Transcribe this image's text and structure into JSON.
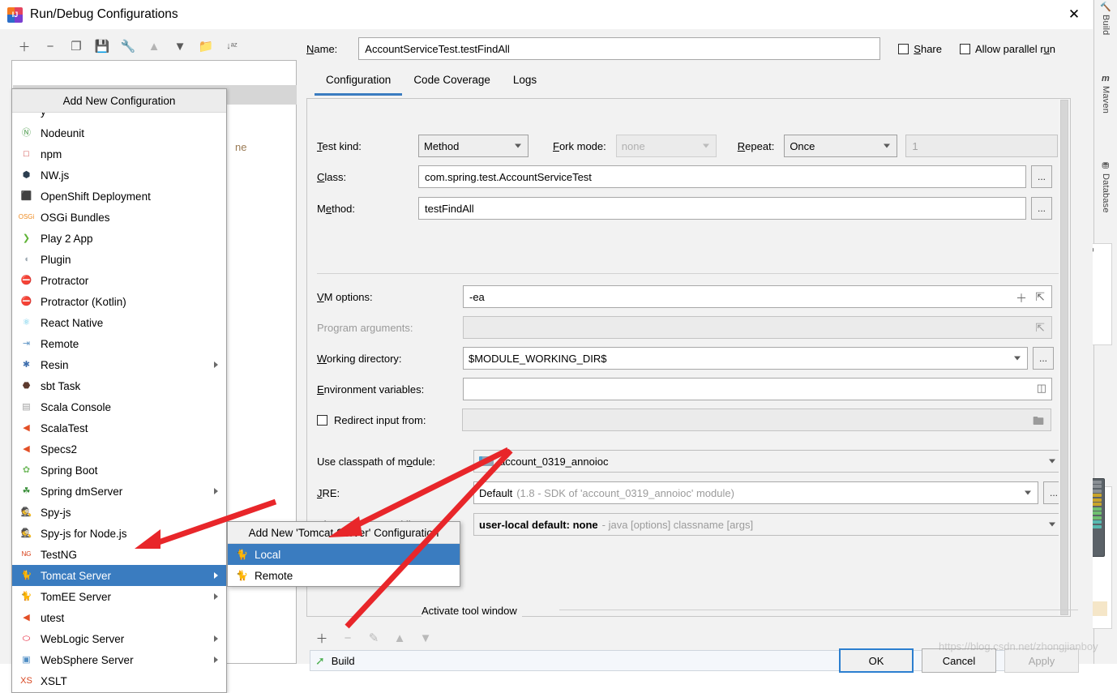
{
  "window": {
    "title": "Run/Debug Configurations",
    "app_icon": "intellij-idea-icon",
    "close_label": "✕"
  },
  "left_toolbar": {
    "items": [
      {
        "name": "add-configuration-button",
        "glyph": "＋",
        "dim": false
      },
      {
        "name": "remove-configuration-button",
        "glyph": "−",
        "dim": false
      },
      {
        "name": "copy-configuration-button",
        "glyph": "❐",
        "dim": false
      },
      {
        "name": "save-configuration-button",
        "glyph": "💾",
        "dim": false
      },
      {
        "name": "edit-templates-button",
        "glyph": "🔧",
        "dim": false
      },
      {
        "name": "move-up-button",
        "glyph": "▲",
        "dim": true
      },
      {
        "name": "move-down-button",
        "glyph": "▼",
        "dim": false
      },
      {
        "name": "create-folder-button",
        "glyph": "📁",
        "dim": false
      },
      {
        "name": "sort-alphabetically-button",
        "glyph": "↓ᵃᶻ",
        "dim": false
      }
    ]
  },
  "config_tree": {
    "partial_text": "ne"
  },
  "add_new_popup": {
    "header": "Add New Configuration",
    "clipped_top_item": "·",
    "items": [
      {
        "label": "Nodeunit",
        "icon": "nodeunit-icon",
        "glyph": "Ⓝ",
        "color": "#4f9d4f",
        "submenu": false,
        "selected": false
      },
      {
        "label": "npm",
        "icon": "npm-icon",
        "glyph": "□",
        "color": "#cb3837",
        "submenu": false,
        "selected": false
      },
      {
        "label": "NW.js",
        "icon": "nwjs-icon",
        "glyph": "⬢",
        "color": "#2c3e50",
        "submenu": false,
        "selected": false
      },
      {
        "label": "OpenShift Deployment",
        "icon": "openshift-icon",
        "glyph": "⬛",
        "color": "#6e6e6e",
        "submenu": false,
        "selected": false
      },
      {
        "label": "OSGi Bundles",
        "icon": "osgi-icon",
        "glyph": "OSGi",
        "color": "#ef8b20",
        "submenu": false,
        "selected": false
      },
      {
        "label": "Play 2 App",
        "icon": "play2-icon",
        "glyph": "❯",
        "color": "#5fb336",
        "submenu": false,
        "selected": false
      },
      {
        "label": "Plugin",
        "icon": "plugin-icon",
        "glyph": "◖",
        "color": "#9aa7b0",
        "submenu": false,
        "selected": false
      },
      {
        "label": "Protractor",
        "icon": "protractor-icon",
        "glyph": "⛔",
        "color": "#d6002a",
        "submenu": false,
        "selected": false
      },
      {
        "label": "Protractor (Kotlin)",
        "icon": "protractor-kotlin-icon",
        "glyph": "⛔",
        "color": "#d6002a",
        "submenu": false,
        "selected": false
      },
      {
        "label": "React Native",
        "icon": "react-native-icon",
        "glyph": "⚛",
        "color": "#5ec8e8",
        "submenu": false,
        "selected": false
      },
      {
        "label": "Remote",
        "icon": "remote-icon",
        "glyph": "⇥",
        "color": "#5b93c4",
        "submenu": false,
        "selected": false
      },
      {
        "label": "Resin",
        "icon": "resin-icon",
        "glyph": "✱",
        "color": "#3f6fae",
        "submenu": true,
        "selected": false
      },
      {
        "label": "sbt Task",
        "icon": "sbt-icon",
        "glyph": "⬣",
        "color": "#5d3a2e",
        "submenu": false,
        "selected": false
      },
      {
        "label": "Scala Console",
        "icon": "scala-console-icon",
        "glyph": "▤",
        "color": "#a0a0a0",
        "submenu": false,
        "selected": false
      },
      {
        "label": "ScalaTest",
        "icon": "scalatest-icon",
        "glyph": "◀",
        "color": "#e34f26",
        "submenu": false,
        "selected": false
      },
      {
        "label": "Specs2",
        "icon": "specs2-icon",
        "glyph": "◀",
        "color": "#e34f26",
        "submenu": false,
        "selected": false
      },
      {
        "label": "Spring Boot",
        "icon": "spring-boot-icon",
        "glyph": "✿",
        "color": "#77bc65",
        "submenu": false,
        "selected": false
      },
      {
        "label": "Spring dmServer",
        "icon": "spring-dmserver-icon",
        "glyph": "☘",
        "color": "#3a8f3a",
        "submenu": true,
        "selected": false
      },
      {
        "label": "Spy-js",
        "icon": "spy-js-icon",
        "glyph": "🕵",
        "color": "#7b9fc4",
        "submenu": false,
        "selected": false
      },
      {
        "label": "Spy-js for Node.js",
        "icon": "spy-js-node-icon",
        "glyph": "🕵",
        "color": "#7b9fc4",
        "submenu": false,
        "selected": false
      },
      {
        "label": "TestNG",
        "icon": "testng-icon",
        "glyph": "N̵G",
        "color": "#d8451f",
        "submenu": false,
        "selected": false
      },
      {
        "label": "Tomcat Server",
        "icon": "tomcat-icon",
        "glyph": "🐈",
        "color": "#c9a227",
        "submenu": true,
        "selected": true
      },
      {
        "label": "TomEE Server",
        "icon": "tomee-icon",
        "glyph": "🐈",
        "color": "#c9a227",
        "submenu": true,
        "selected": false
      },
      {
        "label": "utest",
        "icon": "utest-icon",
        "glyph": "◀",
        "color": "#e34f26",
        "submenu": false,
        "selected": false
      },
      {
        "label": "WebLogic Server",
        "icon": "weblogic-icon",
        "glyph": "⬭",
        "color": "#e3001b",
        "submenu": true,
        "selected": false
      },
      {
        "label": "WebSphere Server",
        "icon": "websphere-icon",
        "glyph": "▣",
        "color": "#4f8ec4",
        "submenu": true,
        "selected": false
      },
      {
        "label": "XSLT",
        "icon": "xslt-icon",
        "glyph": "XS",
        "color": "#d8451f",
        "submenu": false,
        "selected": false
      }
    ]
  },
  "context_menu": {
    "header": "Add New 'Tomcat Server' Configuration",
    "items": [
      {
        "label": "Local",
        "icon": "tomcat-icon",
        "selected": true
      },
      {
        "label": "Remote",
        "icon": "tomcat-icon",
        "selected": false
      }
    ]
  },
  "form": {
    "name_label": "Name:",
    "name_underline": "N",
    "name_value": "AccountServiceTest.testFindAll",
    "share_label": "Share",
    "share_checked": false,
    "allow_parallel_label": "Allow parallel run",
    "allow_parallel_checked": false,
    "tabs": [
      {
        "label": "Configuration",
        "active": true
      },
      {
        "label": "Code Coverage",
        "active": false
      },
      {
        "label": "Logs",
        "active": false
      }
    ],
    "test_kind_label": "Test kind:",
    "test_kind_value": "Method",
    "fork_mode_label": "Fork mode:",
    "fork_mode_value": "none",
    "fork_mode_disabled": true,
    "repeat_label": "Repeat:",
    "repeat_value": "Once",
    "repeat_count_value": "1",
    "repeat_count_disabled": true,
    "class_label": "Class:",
    "class_value": "com.spring.test.AccountServiceTest",
    "method_label": "Method:",
    "method_value": "testFindAll",
    "vm_options_label": "VM options:",
    "vm_options_value": "-ea",
    "program_arguments_label": "Program arguments:",
    "program_arguments_value": "",
    "program_arguments_disabled": true,
    "working_directory_label": "Working directory:",
    "working_directory_value": "$MODULE_WORKING_DIR$",
    "environment_variables_label": "Environment variables:",
    "environment_variables_value": "",
    "redirect_input_label": "Redirect input from:",
    "redirect_input_checked": false,
    "redirect_input_value": "",
    "use_classpath_label": "Use classpath of module:",
    "use_classpath_value": "account_0319_annoioc",
    "jre_label": "JRE:",
    "jre_value": "Default",
    "jre_hint": "(1.8 - SDK of 'account_0319_annoioc' module)",
    "shorten_cmd_label": "Shorten command line:",
    "shorten_cmd_value": "user-local default: none",
    "shorten_cmd_hint": "- java [options] classname [args]",
    "ellipsis": "..."
  },
  "before_launch": {
    "activate_tool_window_label": "Activate tool window",
    "toolbar": [
      {
        "name": "add-task-button",
        "glyph": "＋",
        "dim": false
      },
      {
        "name": "remove-task-button",
        "glyph": "−",
        "dim": true
      },
      {
        "name": "edit-task-button",
        "glyph": "✎",
        "dim": true
      },
      {
        "name": "move-task-up-button",
        "glyph": "▲",
        "dim": true
      },
      {
        "name": "move-task-down-button",
        "glyph": "▼",
        "dim": true
      }
    ],
    "tasks": [
      {
        "label": "Build",
        "icon": "build-hammer-icon"
      }
    ]
  },
  "buttons": {
    "ok": "OK",
    "cancel": "Cancel",
    "apply": "Apply",
    "apply_disabled": true
  },
  "ide_background": {
    "tool_windows": [
      {
        "label": "Build",
        "icon": "build-icon",
        "glyph": "🔨"
      },
      {
        "label": "Maven",
        "icon": "maven-icon",
        "glyph": "m"
      },
      {
        "label": "Database",
        "icon": "database-icon",
        "glyph": "⛃"
      }
    ]
  },
  "watermark": {
    "text": "https://blog.csdn.net/zhongjianboy"
  },
  "colors": {
    "selection_blue": "#3a7cc0",
    "tab_accent": "#3a7cc0",
    "annotation_red": "#e8262a",
    "dialog_bg": "#f2f2f2",
    "field_bg": "#ffffff"
  }
}
